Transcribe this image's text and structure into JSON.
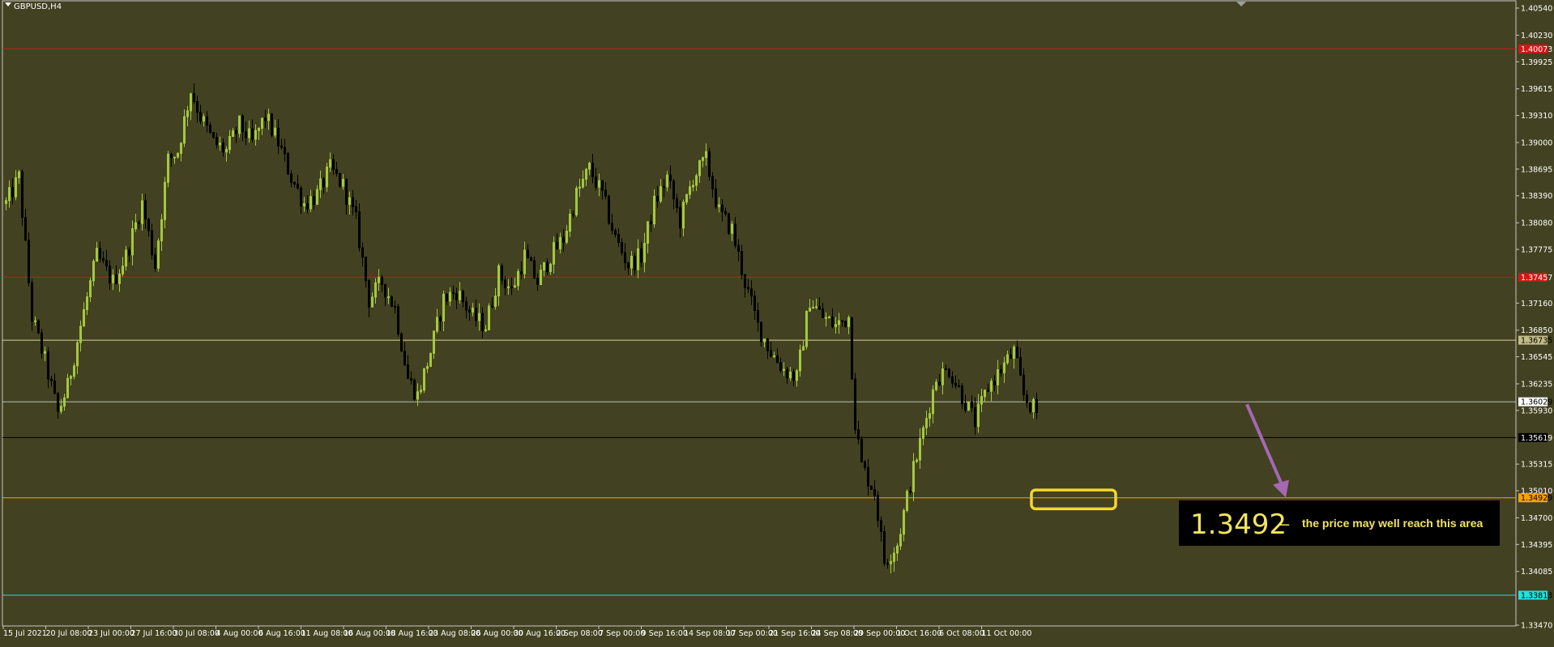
{
  "window": {
    "symbol": "GBPUSD,H4"
  },
  "colors": {
    "background": "#424121",
    "bull_candle": "#a4c83c",
    "bear_candle": "#000000",
    "red_level": "#d01818",
    "pale_level": "#d8d29c",
    "gray_level": "#b9c0b5",
    "black_level": "#000000",
    "orange_level": "#f5a300",
    "cyan_level": "#22e0e0",
    "annotation_arrow": "#a468b4",
    "highlight_box": "#f2d730"
  },
  "annotation": {
    "price": "1.3492",
    "dash": "–",
    "text": "the price may well reach this area"
  },
  "chart_data": {
    "type": "candlestick",
    "timeframe": "H4",
    "ylim": [
      1.3347,
      1.4054
    ],
    "y_ticks": [
      "1.40540",
      "1.40230",
      "1.39925",
      "1.39615",
      "1.39310",
      "1.39000",
      "1.38695",
      "1.38390",
      "1.38080",
      "1.37775",
      "1.37160",
      "1.36850",
      "1.36545",
      "1.36235",
      "1.35930",
      "1.35315",
      "1.35010",
      "1.34700",
      "1.34395",
      "1.34085",
      "1.33470"
    ],
    "x_labels": [
      "15 Jul 2021",
      "20 Jul 08:00",
      "23 Jul 00:00",
      "27 Jul 16:00",
      "30 Jul 08:00",
      "4 Aug 00:00",
      "6 Aug 16:00",
      "11 Aug 08:00",
      "16 Aug 00:00",
      "18 Aug 16:00",
      "23 Aug 08:00",
      "26 Aug 00:00",
      "30 Aug 16:00",
      "2 Sep 08:00",
      "7 Sep 00:00",
      "9 Sep 16:00",
      "14 Sep 08:00",
      "17 Sep 00:00",
      "21 Sep 16:00",
      "24 Sep 08:00",
      "29 Sep 00:00",
      "1 Oct 16:00",
      "6 Oct 08:00",
      "11 Oct 00:00"
    ],
    "horizontal_levels": [
      {
        "value": 1.40073,
        "label": "1.40073",
        "color": "red",
        "tag_bg": "#d01818"
      },
      {
        "value": 1.37457,
        "label": "1.37457",
        "color": "red",
        "tag_bg": "#d01818"
      },
      {
        "value": 1.36735,
        "label": "1.36735",
        "color": "pale",
        "tag_bg": "#c2bc88"
      },
      {
        "value": 1.36029,
        "label": "1.36029",
        "color": "gray",
        "tag_bg": "#ffffff"
      },
      {
        "value": 1.35619,
        "label": "1.35619",
        "color": "black",
        "tag_bg": "#000000"
      },
      {
        "value": 1.34929,
        "label": "1.34929",
        "color": "orange",
        "tag_bg": "#f5a300"
      },
      {
        "value": 1.33813,
        "label": "1.33813",
        "color": "cyan",
        "tag_bg": "#22e0e0"
      }
    ],
    "close_path": [
      [
        0,
        1.383
      ],
      [
        4,
        1.386
      ],
      [
        8,
        1.37
      ],
      [
        12,
        1.365
      ],
      [
        16,
        1.359
      ],
      [
        19,
        1.362
      ],
      [
        23,
        1.369
      ],
      [
        28,
        1.377
      ],
      [
        33,
        1.374
      ],
      [
        37,
        1.377
      ],
      [
        42,
        1.383
      ],
      [
        46,
        1.376
      ],
      [
        50,
        1.388
      ],
      [
        53,
        1.389
      ],
      [
        57,
        1.396
      ],
      [
        60,
        1.393
      ],
      [
        64,
        1.39
      ],
      [
        68,
        1.389
      ],
      [
        72,
        1.392
      ],
      [
        76,
        1.39
      ],
      [
        80,
        1.393
      ],
      [
        84,
        1.39
      ],
      [
        88,
        1.386
      ],
      [
        92,
        1.383
      ],
      [
        96,
        1.384
      ],
      [
        100,
        1.387
      ],
      [
        104,
        1.385
      ],
      [
        108,
        1.381
      ],
      [
        112,
        1.372
      ],
      [
        116,
        1.374
      ],
      [
        120,
        1.371
      ],
      [
        124,
        1.363
      ],
      [
        127,
        1.361
      ],
      [
        131,
        1.366
      ],
      [
        135,
        1.372
      ],
      [
        139,
        1.373
      ],
      [
        144,
        1.37
      ],
      [
        148,
        1.369
      ],
      [
        152,
        1.375
      ],
      [
        156,
        1.373
      ],
      [
        160,
        1.377
      ],
      [
        164,
        1.374
      ],
      [
        168,
        1.377
      ],
      [
        172,
        1.379
      ],
      [
        176,
        1.384
      ],
      [
        180,
        1.387
      ],
      [
        184,
        1.384
      ],
      [
        188,
        1.379
      ],
      [
        192,
        1.376
      ],
      [
        196,
        1.377
      ],
      [
        200,
        1.383
      ],
      [
        204,
        1.386
      ],
      [
        208,
        1.381
      ],
      [
        212,
        1.386
      ],
      [
        216,
        1.388
      ],
      [
        220,
        1.382
      ],
      [
        224,
        1.38
      ],
      [
        228,
        1.374
      ],
      [
        232,
        1.369
      ],
      [
        236,
        1.366
      ],
      [
        240,
        1.364
      ],
      [
        244,
        1.363
      ],
      [
        248,
        1.372
      ],
      [
        252,
        1.37
      ],
      [
        256,
        1.369
      ],
      [
        260,
        1.37
      ],
      [
        262,
        1.358
      ],
      [
        264,
        1.353
      ],
      [
        268,
        1.35
      ],
      [
        271,
        1.342
      ],
      [
        275,
        1.344
      ],
      [
        279,
        1.351
      ],
      [
        283,
        1.357
      ],
      [
        287,
        1.363
      ],
      [
        291,
        1.364
      ],
      [
        295,
        1.361
      ],
      [
        299,
        1.358
      ],
      [
        303,
        1.362
      ],
      [
        307,
        1.364
      ],
      [
        311,
        1.366
      ],
      [
        314,
        1.361
      ],
      [
        318,
        1.359
      ]
    ],
    "drawings": [
      {
        "type": "rectangle",
        "price_top": 1.35,
        "price_bottom": 1.3484,
        "x_from": "28 Sep 04:00",
        "x_to": "2 Oct 00:00"
      },
      {
        "type": "arrow",
        "from_price": 1.36,
        "to_price": 1.3495,
        "direction": "down"
      }
    ]
  }
}
